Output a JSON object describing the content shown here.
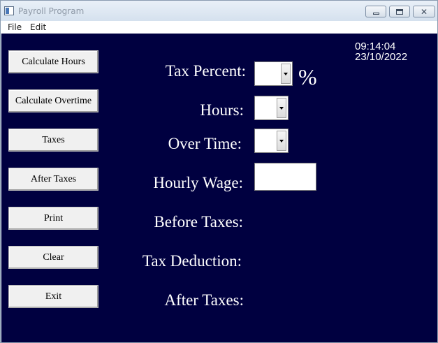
{
  "window": {
    "title": "Payroll Program",
    "controls": {
      "minimize_icon": "minimize-icon",
      "maximize_icon": "maximize-icon",
      "close_icon": "close-icon",
      "close_glyph": "✕"
    }
  },
  "menu": {
    "file": "File",
    "edit": "Edit"
  },
  "clock": {
    "time": "09:14:04",
    "date": "23/10/2022"
  },
  "buttons": {
    "calculate_hours": "Calculate Hours",
    "calculate_overtime": "Calculate Overtime",
    "taxes": "Taxes",
    "after_taxes": "After Taxes",
    "print": "Print",
    "clear": "Clear",
    "exit": "Exit"
  },
  "form": {
    "tax_percent_label": "Tax Percent:",
    "percent_symbol": "%",
    "hours_label": "Hours:",
    "overtime_label": "Over Time:",
    "hourly_wage_label": "Hourly Wage:",
    "before_taxes_label": "Before Taxes:",
    "tax_deduction_label": "Tax Deduction:",
    "after_taxes_label": "After Taxes:",
    "tax_percent_value": "",
    "hours_value": "",
    "overtime_value": "",
    "hourly_wage_value": ""
  },
  "colors": {
    "client_background": "#000040",
    "text": "#ffffff",
    "button_face": "#f0f0f0"
  }
}
